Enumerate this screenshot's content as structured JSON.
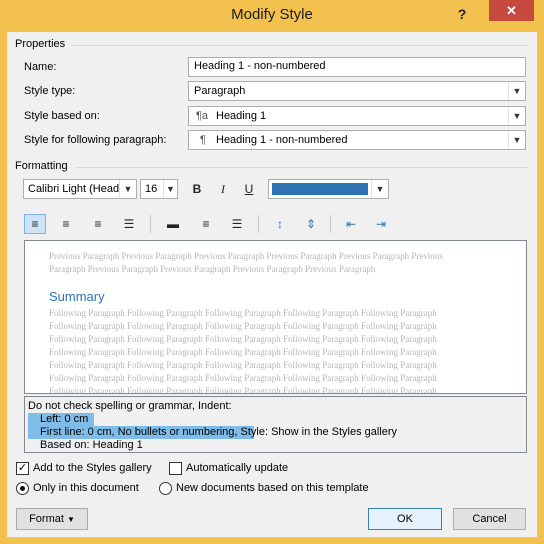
{
  "window": {
    "title": "Modify Style",
    "help": "?",
    "close": "✕"
  },
  "properties": {
    "heading": "Properties",
    "name_label": "Name:",
    "name_value": "Heading 1  - non-numbered",
    "style_type_label": "Style type:",
    "style_type_value": "Paragraph",
    "based_on_label": "Style based on:",
    "based_on_value": "Heading 1",
    "following_label": "Style for following paragraph:",
    "following_value": "Heading 1  - non-numbered"
  },
  "formatting": {
    "heading": "Formatting",
    "font": "Calibri Light (Head",
    "size": "16",
    "bold": "B",
    "italic": "I",
    "underline": "U",
    "color": "#2e74b5"
  },
  "preview": {
    "previous": [
      "Previous Paragraph Previous Paragraph Previous Paragraph Previous Paragraph Previous Paragraph Previous",
      "Paragraph Previous Paragraph Previous Paragraph Previous Paragraph Previous Paragraph"
    ],
    "sample": "Summary",
    "following": [
      "Following Paragraph Following Paragraph Following Paragraph Following Paragraph Following Paragraph",
      "Following Paragraph Following Paragraph Following Paragraph Following Paragraph Following Paragraph",
      "Following Paragraph Following Paragraph Following Paragraph Following Paragraph Following Paragraph",
      "Following Paragraph Following Paragraph Following Paragraph Following Paragraph Following Paragraph",
      "Following Paragraph Following Paragraph Following Paragraph Following Paragraph Following Paragraph",
      "Following Paragraph Following Paragraph Following Paragraph Following Paragraph Following Paragraph",
      "Following Paragraph Following Paragraph Following Paragraph Following Paragraph Following Paragraph"
    ]
  },
  "description": {
    "line1": "Do not check spelling or grammar, Indent:",
    "line2": "Left:  0 cm",
    "line3_hl": "First line:  0 cm,  No bullets or numbering,",
    "line3_rest": " Style: Show in the Styles gallery",
    "line4": "Based on: Heading 1"
  },
  "options": {
    "add_gallery": "Add to the Styles gallery",
    "auto_update": "Automatically update",
    "only_doc": "Only in this document",
    "new_docs": "New documents based on this template"
  },
  "buttons": {
    "format": "Format",
    "ok": "OK",
    "cancel": "Cancel"
  }
}
